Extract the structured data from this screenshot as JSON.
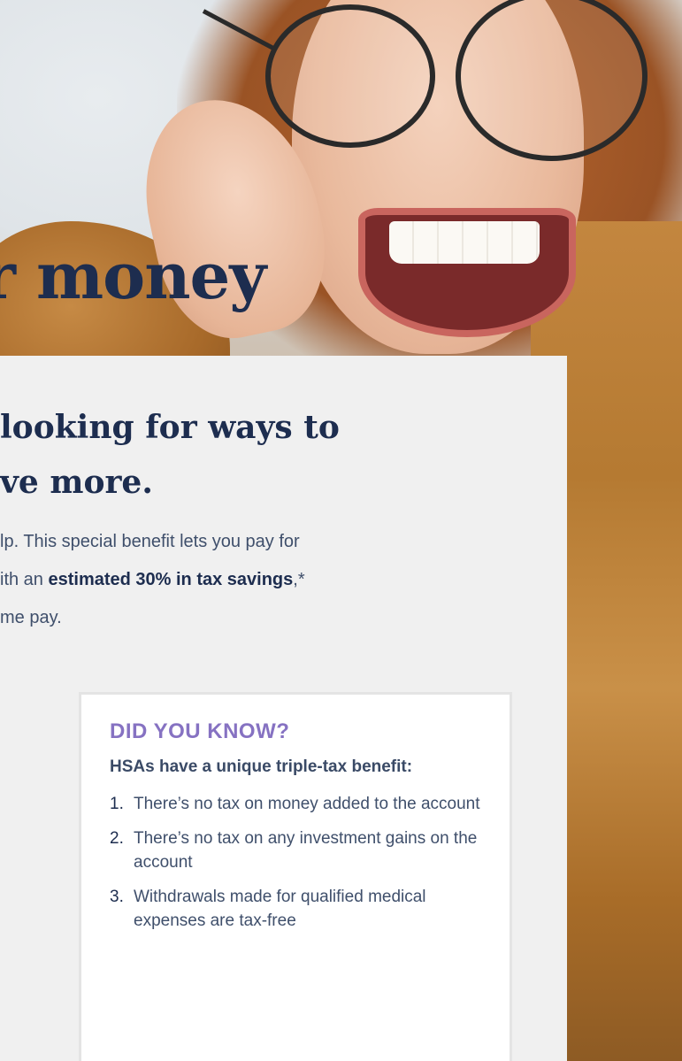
{
  "hero": {
    "headline": "r money",
    "photo_icon": "smiling-woman-photo"
  },
  "intro": {
    "subheadline_line1": "looking for ways to",
    "subheadline_line2": "ve more.",
    "body_line1": "lp. This special benefit lets you pay for",
    "body_line2_prefix": "ith an ",
    "body_line2_bold": "estimated 30% in tax savings",
    "body_line2_suffix": ",*",
    "body_line3": "me pay."
  },
  "did_you_know": {
    "title": "DID YOU KNOW?",
    "lead": "HSAs have a unique triple-tax benefit:",
    "items": [
      {
        "num": "1.",
        "text": "There’s no tax on money added to the account"
      },
      {
        "num": "2.",
        "text": "There’s no tax on any investment gains on the account"
      },
      {
        "num": "3.",
        "text": "Withdrawals made for qualified medical expenses are tax-free"
      }
    ]
  },
  "colors": {
    "navy": "#1d2d4f",
    "accent_purple": "#8672c2",
    "panel_bg": "#f0f0f0"
  }
}
